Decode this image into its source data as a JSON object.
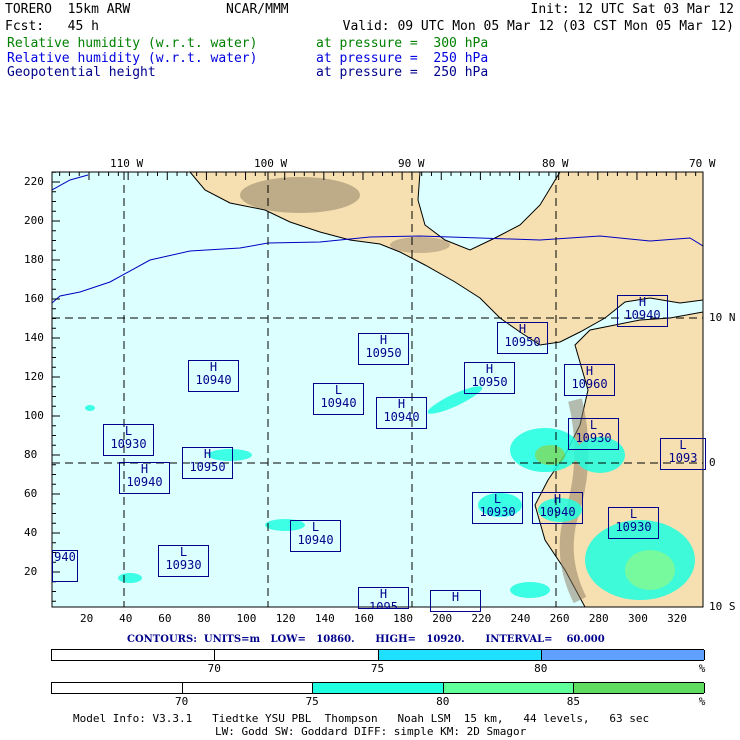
{
  "header": {
    "model": "TORERO  15km ARW",
    "org": "NCAR/MMM",
    "init": "Init: 12 UTC Sat 03 Mar 12",
    "fcst": "Fcst:   45 h",
    "valid": "Valid: 09 UTC Mon 05 Mar 12 (03 CST Mon 05 Mar 12)",
    "fields": [
      {
        "name": "Relative humidity (w.r.t. water)",
        "level": "at pressure =  300 hPa",
        "color": "#008000"
      },
      {
        "name": "Relative humidity (w.r.t. water)",
        "level": "at pressure =  250 hPa",
        "color": "#0000e0"
      },
      {
        "name": "Geopotential height",
        "level": "at pressure =  250 hPa",
        "color": "#00008b"
      }
    ]
  },
  "map": {
    "lon_labels": [
      "110 W",
      "100 W",
      "90 W",
      "80 W",
      "70 W"
    ],
    "lat_labels": [
      "10 N",
      "0",
      "10 S"
    ],
    "y_ticks": [
      "220",
      "200",
      "180",
      "160",
      "140",
      "120",
      "100",
      "80",
      "60",
      "40",
      "20"
    ],
    "x_ticks": [
      "20",
      "40",
      "60",
      "80",
      "100",
      "120",
      "140",
      "160",
      "180",
      "200",
      "220",
      "240",
      "260",
      "280",
      "300",
      "320"
    ],
    "centers": [
      {
        "type": "H",
        "value": "10940"
      },
      {
        "type": "H",
        "value": "10950"
      },
      {
        "type": "H",
        "value": "10950"
      },
      {
        "type": "H",
        "value": "10940"
      },
      {
        "type": "H",
        "value": "10950"
      },
      {
        "type": "H",
        "value": "10960"
      },
      {
        "type": "L",
        "value": "10940"
      },
      {
        "type": "H",
        "value": "10940"
      },
      {
        "type": "L",
        "value": "10930"
      },
      {
        "type": "L",
        "value": "10930"
      },
      {
        "type": "H",
        "value": "10950"
      },
      {
        "type": "L",
        "value": "1093"
      },
      {
        "type": "H",
        "value": "10940"
      },
      {
        "type": "L",
        "value": "10930"
      },
      {
        "type": "H",
        "value": "10940"
      },
      {
        "type": "L",
        "value": "10930"
      },
      {
        "type": "L",
        "value": "10940"
      },
      {
        "type": "L",
        "value": "10930"
      },
      {
        "type": "",
        "value": "940"
      },
      {
        "type": "H",
        "value": "1095"
      },
      {
        "type": "H",
        "value": ""
      }
    ]
  },
  "contours": "CONTOURS:  UNITS=m   LOW=   10860.      HIGH=   10920.      INTERVAL=    60.000",
  "colorbar_250": {
    "labels": [
      "70",
      "75",
      "80",
      "%"
    ],
    "colors": [
      "#ffffff",
      "#ffffff",
      "#20e0ff",
      "#60a0ff"
    ]
  },
  "colorbar_300": {
    "labels": [
      "70",
      "75",
      "80",
      "85",
      "%"
    ],
    "colors": [
      "#ffffff",
      "#ffffff",
      "#20ffe0",
      "#60ff9a",
      "#60dc60"
    ]
  },
  "footer": {
    "line1": "Model Info: V3.3.1   Tiedtke YSU PBL  Thompson   Noah LSM  15 km,   44 levels,   63 sec",
    "line2": "LW: Godd SW: Goddard DIFF: simple KM: 2D Smagor"
  }
}
